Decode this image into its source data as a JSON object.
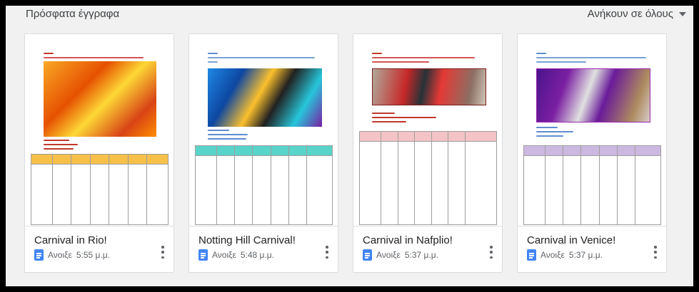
{
  "header": {
    "section_title": "Πρόσφατα έγγραφα",
    "owner_filter": "Ανήκουν σε όλους"
  },
  "colors": {
    "doc_icon": "#4285f4",
    "rio_header": "#f7c04a",
    "notting_header": "#59d4c8",
    "nafplio_header": "#f3c3c6",
    "venice_header": "#cdb8e2"
  },
  "documents": [
    {
      "title": "Carnival in Rio!",
      "action": "Ανοιξε",
      "time": "5:55 μ.μ."
    },
    {
      "title": "Notting Hill Carnival!",
      "action": "Ανοιξε",
      "time": "5:48 μ.μ."
    },
    {
      "title": "Carnival in Nafplio!",
      "action": "Ανοιξε",
      "time": "5:37 μ.μ."
    },
    {
      "title": "Carnival in Venice!",
      "action": "Ανοιξε",
      "time": "5:37 μ.μ."
    }
  ]
}
